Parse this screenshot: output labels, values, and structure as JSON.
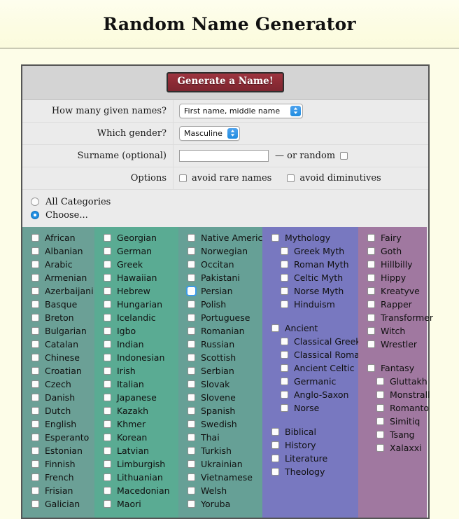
{
  "header": {
    "title": "Random Name Generator"
  },
  "form": {
    "generate_button": "Generate a Name!",
    "rows": {
      "given_names": {
        "label": "How many given names?",
        "value": "First name, middle name"
      },
      "gender": {
        "label": "Which gender?",
        "value": "Masculine"
      },
      "surname": {
        "label": "Surname (optional)",
        "value": "",
        "placeholder": "",
        "or_random_label": "— or random"
      },
      "options": {
        "label": "Options",
        "items": [
          {
            "label": "avoid rare names",
            "checked": false
          },
          {
            "label": "avoid diminutives",
            "checked": false
          }
        ]
      }
    }
  },
  "category_mode": {
    "all": {
      "label": "All Categories",
      "checked": false
    },
    "choose": {
      "label": "Choose...",
      "checked": true
    }
  },
  "categories": {
    "columns": [
      {
        "name": "languages-a",
        "color": "#6ba096",
        "items": [
          {
            "label": "African"
          },
          {
            "label": "Albanian"
          },
          {
            "label": "Arabic"
          },
          {
            "label": "Armenian"
          },
          {
            "label": "Azerbaijani"
          },
          {
            "label": "Basque"
          },
          {
            "label": "Breton"
          },
          {
            "label": "Bulgarian"
          },
          {
            "label": "Catalan"
          },
          {
            "label": "Chinese"
          },
          {
            "label": "Croatian"
          },
          {
            "label": "Czech"
          },
          {
            "label": "Danish"
          },
          {
            "label": "Dutch"
          },
          {
            "label": "English"
          },
          {
            "label": "Esperanto"
          },
          {
            "label": "Estonian"
          },
          {
            "label": "Finnish"
          },
          {
            "label": "French"
          },
          {
            "label": "Frisian"
          },
          {
            "label": "Galician"
          }
        ]
      },
      {
        "name": "languages-b",
        "color": "#5aab93",
        "items": [
          {
            "label": "Georgian"
          },
          {
            "label": "German"
          },
          {
            "label": "Greek"
          },
          {
            "label": "Hawaiian"
          },
          {
            "label": "Hebrew"
          },
          {
            "label": "Hungarian"
          },
          {
            "label": "Icelandic"
          },
          {
            "label": "Igbo"
          },
          {
            "label": "Indian"
          },
          {
            "label": "Indonesian"
          },
          {
            "label": "Irish"
          },
          {
            "label": "Italian"
          },
          {
            "label": "Japanese"
          },
          {
            "label": "Kazakh"
          },
          {
            "label": "Khmer"
          },
          {
            "label": "Korean"
          },
          {
            "label": "Latvian"
          },
          {
            "label": "Limburgish"
          },
          {
            "label": "Lithuanian"
          },
          {
            "label": "Macedonian"
          },
          {
            "label": "Maori"
          }
        ]
      },
      {
        "name": "languages-c",
        "color": "#66a096",
        "items": [
          {
            "label": "Native American"
          },
          {
            "label": "Norwegian"
          },
          {
            "label": "Occitan"
          },
          {
            "label": "Pakistani"
          },
          {
            "label": "Persian",
            "focused": true
          },
          {
            "label": "Polish"
          },
          {
            "label": "Portuguese"
          },
          {
            "label": "Romanian"
          },
          {
            "label": "Russian"
          },
          {
            "label": "Scottish"
          },
          {
            "label": "Serbian"
          },
          {
            "label": "Slovak"
          },
          {
            "label": "Slovene"
          },
          {
            "label": "Spanish"
          },
          {
            "label": "Swedish"
          },
          {
            "label": "Thai"
          },
          {
            "label": "Turkish"
          },
          {
            "label": "Ukrainian"
          },
          {
            "label": "Vietnamese"
          },
          {
            "label": "Welsh"
          },
          {
            "label": "Yoruba"
          }
        ]
      },
      {
        "name": "mythology",
        "color": "#7878c0",
        "items": [
          {
            "label": "Mythology"
          },
          {
            "label": "Greek Myth",
            "sub": true
          },
          {
            "label": "Roman Myth",
            "sub": true
          },
          {
            "label": "Celtic Myth",
            "sub": true
          },
          {
            "label": "Norse Myth",
            "sub": true
          },
          {
            "label": "Hinduism",
            "sub": true
          },
          {
            "gap": true
          },
          {
            "label": "Ancient"
          },
          {
            "label": "Classical Greek",
            "sub": true
          },
          {
            "label": "Classical Roman",
            "sub": true
          },
          {
            "label": "Ancient Celtic",
            "sub": true
          },
          {
            "label": "Germanic",
            "sub": true
          },
          {
            "label": "Anglo-Saxon",
            "sub": true
          },
          {
            "label": "Norse",
            "sub": true
          },
          {
            "gap": true
          },
          {
            "label": "Biblical"
          },
          {
            "label": "History"
          },
          {
            "label": "Literature"
          },
          {
            "label": "Theology"
          }
        ]
      },
      {
        "name": "fantasy",
        "color": "#a078a0",
        "items": [
          {
            "label": "Fairy"
          },
          {
            "label": "Goth"
          },
          {
            "label": "Hillbilly"
          },
          {
            "label": "Hippy"
          },
          {
            "label": "Kreatyve"
          },
          {
            "label": "Rapper"
          },
          {
            "label": "Transformer"
          },
          {
            "label": "Witch"
          },
          {
            "label": "Wrestler"
          },
          {
            "gap": true
          },
          {
            "label": "Fantasy"
          },
          {
            "label": "Gluttakh",
            "sub": true
          },
          {
            "label": "Monstrall",
            "sub": true
          },
          {
            "label": "Romanto",
            "sub": true
          },
          {
            "label": "Simitiq",
            "sub": true
          },
          {
            "label": "Tsang",
            "sub": true
          },
          {
            "label": "Xalaxxi",
            "sub": true
          }
        ]
      }
    ]
  }
}
